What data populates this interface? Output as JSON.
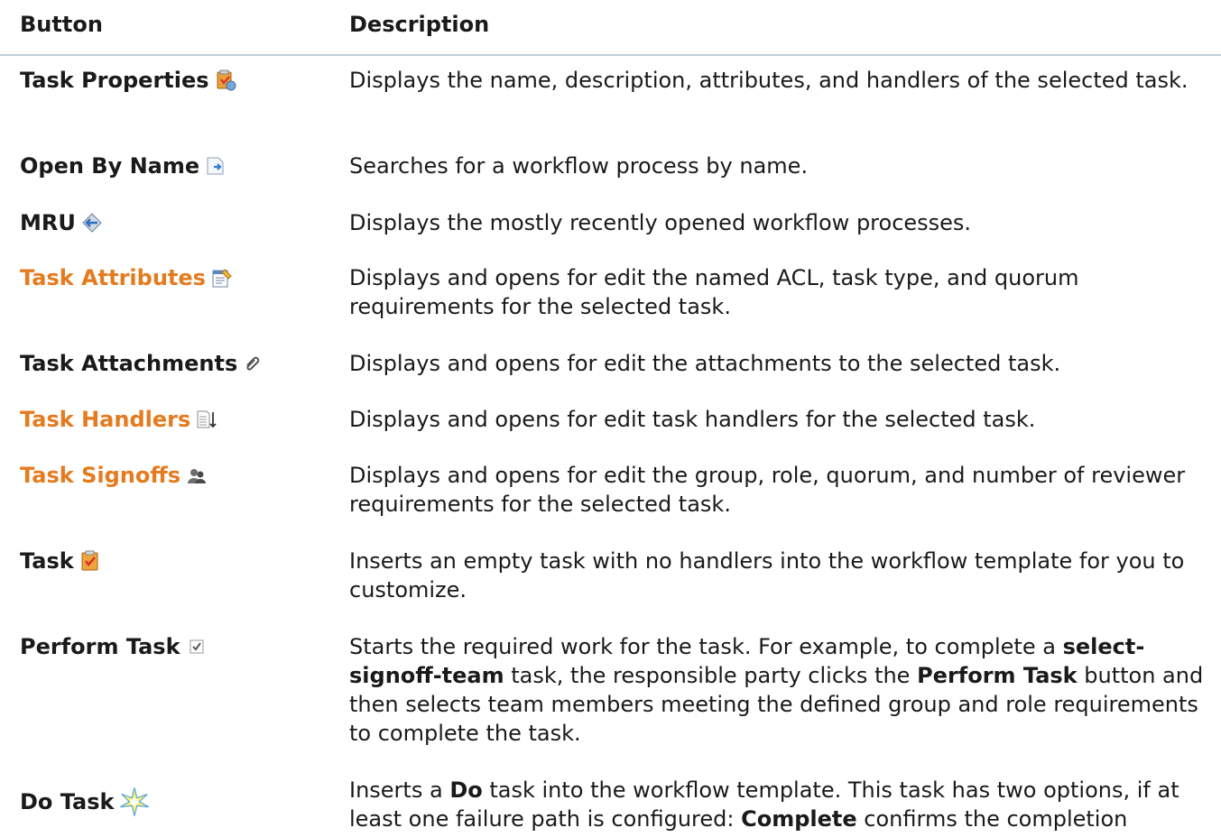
{
  "header": {
    "button_col": "Button",
    "description_col": "Description"
  },
  "rows": [
    {
      "name": "Task Properties",
      "link": false,
      "icon": "task-properties-icon",
      "description": "Displays the name, description, attributes, and handlers of the selected task."
    },
    {
      "name": "Open By Name",
      "link": false,
      "icon": "open-by-name-icon",
      "description": "Searches for a workflow process by name."
    },
    {
      "name": "MRU",
      "link": false,
      "icon": "mru-icon",
      "description": "Displays the mostly recently opened workflow processes."
    },
    {
      "name": "Task Attributes",
      "link": true,
      "icon": "task-attributes-icon",
      "description": "Displays and opens for edit the named ACL, task type, and quorum requirements for the selected task."
    },
    {
      "name": "Task Attachments",
      "link": false,
      "icon": "task-attachments-icon",
      "description": "Displays and opens for edit the attachments to the selected task."
    },
    {
      "name": "Task Handlers",
      "link": true,
      "icon": "task-handlers-icon",
      "description": "Displays and opens for edit task handlers for the selected task."
    },
    {
      "name": "Task Signoffs",
      "link": true,
      "icon": "task-signoffs-icon",
      "description": "Displays and opens for edit the group, role, quorum, and number of reviewer requirements for the selected task."
    },
    {
      "name": "Task",
      "link": false,
      "icon": "task-icon",
      "description": "Inserts an empty task with no handlers into the workflow template for you to customize."
    },
    {
      "name": "Perform Task",
      "link": false,
      "icon": "perform-task-icon",
      "description_parts": {
        "p1": "Starts the required work for the task. For example, to complete a ",
        "b1": "select-signoff-team",
        "p2": " task, the responsible party clicks the ",
        "b2": "Perform Task",
        "p3": " button and then selects team members meeting the defined group and role requirements to complete the task."
      }
    },
    {
      "name": "Do Task",
      "link": false,
      "icon": "do-task-icon",
      "description_parts": {
        "p1": "Inserts a ",
        "b1": "Do",
        "p2": " task into the workflow template. This task has two options, if at least one failure path is configured: ",
        "b2": "Complete",
        "p3": " confirms the completion"
      }
    }
  ],
  "colors": {
    "link": "#e57b1e",
    "text": "#1a1a1a",
    "header_rule": "#c3ccd6"
  }
}
